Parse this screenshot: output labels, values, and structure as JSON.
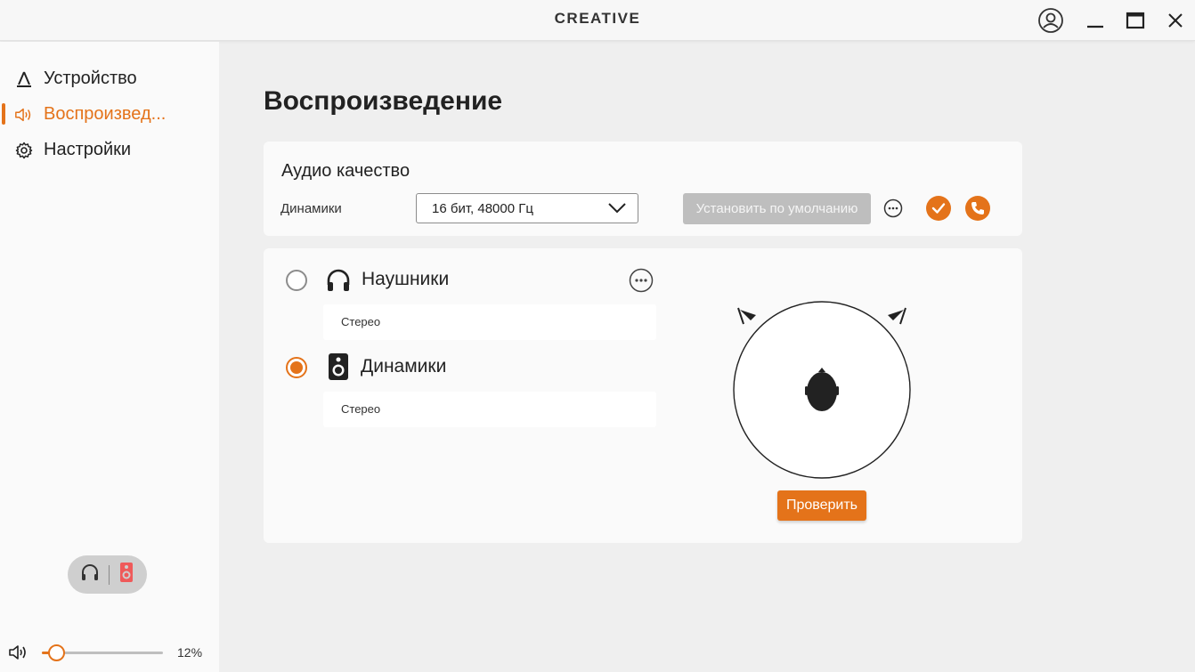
{
  "app": {
    "brand": "CREATIVE"
  },
  "sidebar": {
    "items": [
      {
        "label": "Устройство",
        "icon": "device-icon",
        "active": false
      },
      {
        "label": "Воспроизвед...",
        "icon": "speaker-volume-icon",
        "active": true
      },
      {
        "label": "Настройки",
        "icon": "gear-icon",
        "active": false
      }
    ],
    "output_toggle": {
      "left_icon": "headphones-icon",
      "right_icon": "speaker-icon"
    },
    "volume": {
      "value": 0.12,
      "label": "12%"
    }
  },
  "main": {
    "title": "Воспроизведение",
    "audio_quality": {
      "heading": "Аудио качество",
      "row_label": "Динамики",
      "format_value": "16 бит, 48000 Гц",
      "set_default_label": "Установить по умолчанию"
    },
    "outputs": [
      {
        "name": "Наушники",
        "mode": "Стерео",
        "selected": false,
        "icon": "headphones-icon"
      },
      {
        "name": "Динамики",
        "mode": "Стерео",
        "selected": true,
        "icon": "speaker-icon"
      }
    ],
    "test_label": "Проверить"
  },
  "colors": {
    "accent": "#e4731a",
    "background": "#efefef",
    "card": "#fafafa"
  }
}
